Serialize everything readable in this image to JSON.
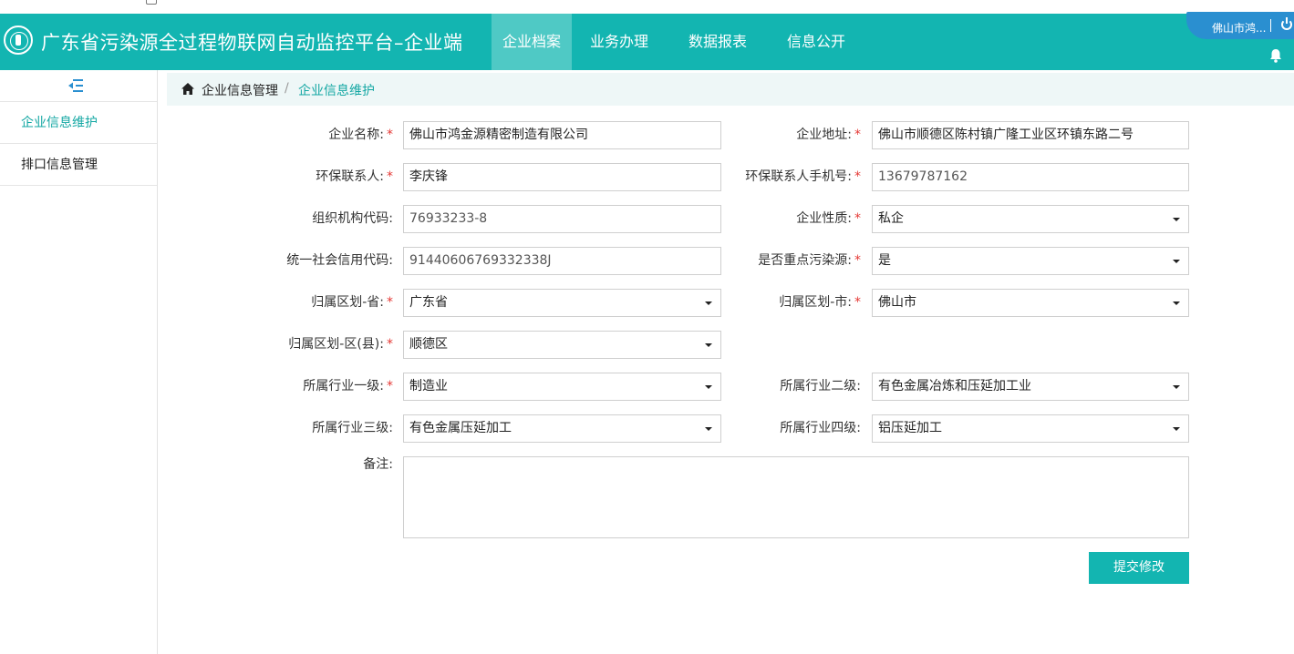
{
  "header": {
    "app_title": "广东省污染源全过程物联网自动监控平台–企业端",
    "nav": [
      "企业档案",
      "业务办理",
      "数据报表",
      "信息公开"
    ],
    "user_name": "佛山市鸿...",
    "accent_color": "#13b5b1"
  },
  "sidebar": {
    "items": [
      "企业信息维护",
      "排口信息管理"
    ]
  },
  "breadcrumb": {
    "parent": "企业信息管理",
    "separator": "/",
    "current": "企业信息维护"
  },
  "form": {
    "company_name": {
      "label": "企业名称:",
      "value": "佛山市鸿金源精密制造有限公司"
    },
    "company_address": {
      "label": "企业地址:",
      "value": "佛山市顺德区陈村镇广隆工业区环镇东路二号"
    },
    "env_contact": {
      "label": "环保联系人:",
      "value": "李庆锋"
    },
    "env_contact_phone": {
      "label": "环保联系人手机号:",
      "value": "13679787162"
    },
    "org_code": {
      "label": "组织机构代码:",
      "value": "76933233-8"
    },
    "company_type": {
      "label": "企业性质:",
      "value": "私企"
    },
    "credit_code": {
      "label": "统一社会信用代码:",
      "value": "91440606769332338J"
    },
    "key_polluter": {
      "label": "是否重点污染源:",
      "value": "是"
    },
    "region_province": {
      "label": "归属区划-省:",
      "value": "广东省"
    },
    "region_city": {
      "label": "归属区划-市:",
      "value": "佛山市"
    },
    "region_district": {
      "label": "归属区划-区(县):",
      "value": "顺德区"
    },
    "industry_1": {
      "label": "所属行业一级:",
      "value": "制造业"
    },
    "industry_2": {
      "label": "所属行业二级:",
      "value": "有色金属冶炼和压延加工业"
    },
    "industry_3": {
      "label": "所属行业三级:",
      "value": "有色金属压延加工"
    },
    "industry_4": {
      "label": "所属行业四级:",
      "value": "铝压延加工"
    },
    "remark": {
      "label": "备注:",
      "value": ""
    },
    "required_mark": "*",
    "submit_label": "提交修改"
  }
}
